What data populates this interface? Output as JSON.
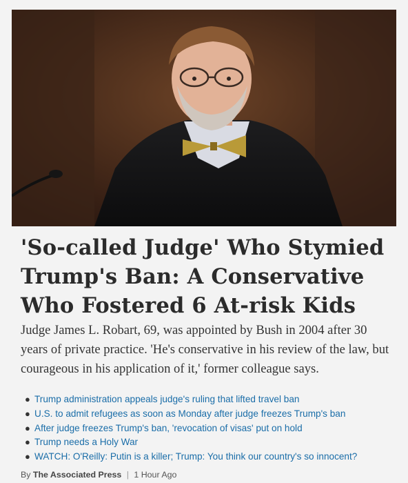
{
  "article": {
    "image_alt": "judge-photo",
    "headline": "'So-called Judge' Who Stymied Trump's Ban: A Conservative Who Fostered 6 At-risk Kids",
    "summary": "Judge James L. Robart, 69, was appointed by Bush in 2004 after 30 years of private practice. 'He's conservative in his review of the law, but courageous in his application of it,' former colleague says.",
    "related": [
      "Trump administration appeals judge's ruling that lifted travel ban",
      "U.S. to admit refugees as soon as Monday after judge freezes Trump's ban",
      "After judge freezes Trump's ban, 'revocation of visas' put on hold",
      "Trump needs a Holy War",
      "WATCH: O'Reilly: Putin is a killer; Trump: You think our country's so innocent?"
    ],
    "byline_prefix": "By",
    "source": "The Associated Press",
    "separator": "|",
    "time": "1 Hour Ago"
  },
  "colors": {
    "link": "#1a6da8",
    "headline": "#2b2b2b",
    "background": "#f3f3f3"
  }
}
